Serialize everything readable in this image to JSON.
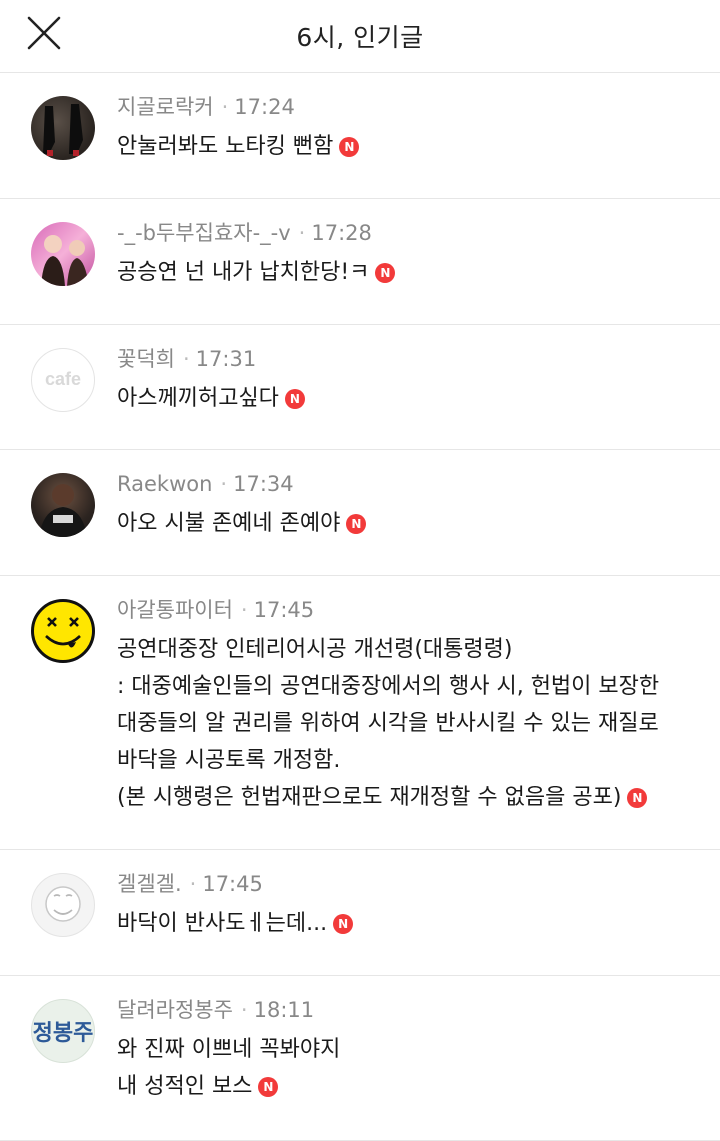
{
  "header": {
    "title": "6시, 인기글"
  },
  "posts": [
    {
      "author": "지골로락커",
      "time": "17:24",
      "lines": [
        "안눌러봐도 노타킹 뻔함"
      ]
    },
    {
      "author": "-_-b두부집효자-_-v",
      "time": "17:28",
      "lines": [
        "공승연 넌 내가 납치한당!ㅋ"
      ]
    },
    {
      "author": "꽃덕희",
      "time": "17:31",
      "lines": [
        "아스께끼허고싶다"
      ],
      "avatar_text": "cafe"
    },
    {
      "author": "Raekwon",
      "time": "17:34",
      "lines": [
        "아오 시불 존예네 존예야"
      ]
    },
    {
      "author": "아갈통파이터",
      "time": "17:45",
      "lines": [
        "공연대중장 인테리어시공 개선령(대통령령)",
        ": 대중예술인들의 공연대중장에서의 행사 시, 헌법이 보장한",
        "대중들의 알 권리를 위하여 시각을 반사시킬 수 있는 재질로",
        "바닥을 시공토록 개정함.",
        "(본 시행령은 헌법재판으로도 재개정할 수 없음을 공포)"
      ]
    },
    {
      "author": "겔겔겔.",
      "time": "17:45",
      "lines": [
        "바닥이 반사도ㅔ는데..."
      ]
    },
    {
      "author": "달려라정봉주",
      "time": "18:11",
      "lines": [
        "와 진짜 이쁘네 꼭봐야지",
        "내 성적인 보스"
      ],
      "avatar_text": "정봉주"
    }
  ],
  "badge_label": "N",
  "badge_color": "#f23a3a",
  "icons": {
    "close": "close-icon",
    "new_badge": "new-badge-icon"
  }
}
